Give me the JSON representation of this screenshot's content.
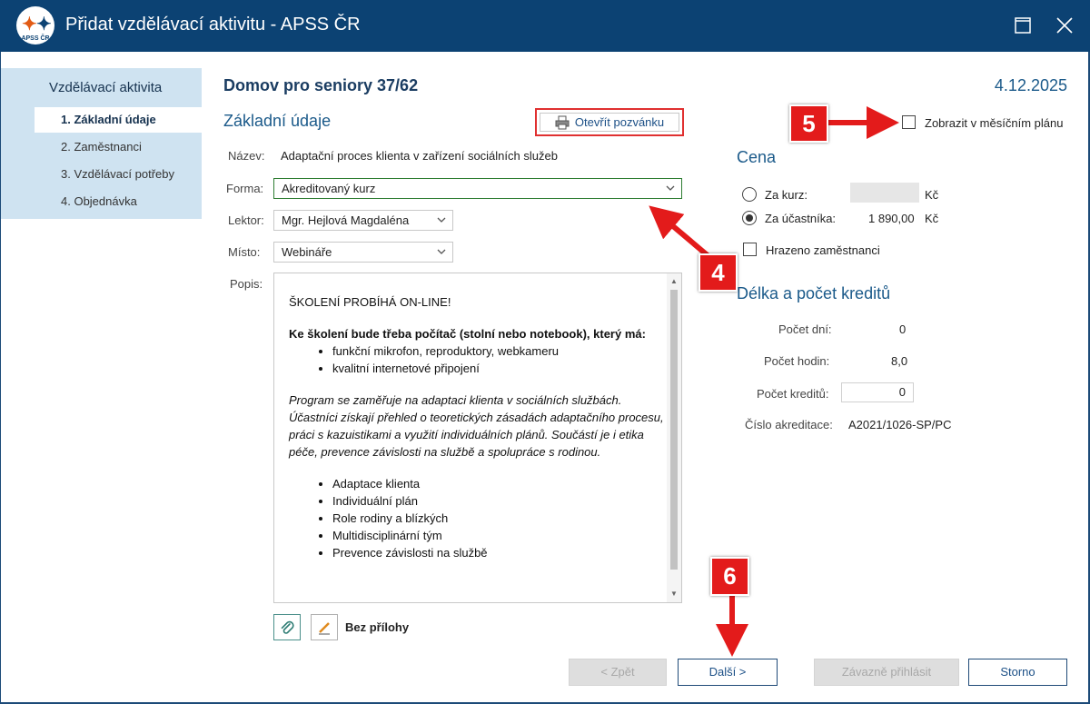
{
  "window": {
    "title": "Přidat vzdělávací aktivitu - APSS ČR",
    "logo_text": "APSS ČR"
  },
  "sidebar": {
    "title": "Vzdělávací aktivita",
    "items": [
      {
        "label": "1. Základní údaje"
      },
      {
        "label": "2. Zaměstnanci"
      },
      {
        "label": "3. Vzdělávací potřeby"
      },
      {
        "label": "4. Objednávka"
      }
    ]
  },
  "header": {
    "organization": "Domov pro seniory 37/62",
    "date": "4.12.2025"
  },
  "basic": {
    "section_title": "Základní údaje",
    "open_invite_label": "Otevřít pozvánku",
    "name_label": "Název:",
    "name_value": "Adaptační proces klienta v zařízení sociálních služeb",
    "form_label": "Forma:",
    "form_value": "Akreditovaný kurz",
    "lecturer_label": "Lektor:",
    "lecturer_value": "Mgr. Hejlová Magdaléna",
    "place_label": "Místo:",
    "place_value": "Webináře",
    "description_label": "Popis:"
  },
  "description": {
    "line1": "ŠKOLENÍ PROBÍHÁ ON-LINE!",
    "bold_line": "Ke školení bude třeba počítač (stolní nebo notebook), který má:",
    "requirements": [
      "funkční mikrofon, reproduktory, webkameru",
      "kvalitní internetové připojení"
    ],
    "italic_text": "Program se zaměřuje na adaptaci klienta v sociálních službách. Účastníci získají přehled o teoretických zásadách adaptačního procesu, práci s kazuistikami a využití individuálních plánů. Součástí je i etika péče, prevence závislosti na službě a spolupráce s rodinou.",
    "topics": [
      "Adaptace klienta",
      "Individuální plán",
      "Role rodiny a blízkých",
      "Multidisciplinární tým",
      "Prevence závislosti na službě"
    ]
  },
  "attachments": {
    "label": "Bez přílohy"
  },
  "monthly_plan": {
    "label": "Zobrazit v měsíčním plánu",
    "checked": false
  },
  "price": {
    "title": "Cena",
    "per_course_label": "Za kurz:",
    "per_course_value": "",
    "per_participant_label": "Za účastníka:",
    "per_participant_value": "1 890,00",
    "currency": "Kč",
    "selected": "per_participant",
    "employee_paid_label": "Hrazeno zaměstnanci",
    "employee_paid_checked": false
  },
  "credits": {
    "title": "Délka a počet kreditů",
    "days_label": "Počet dní:",
    "days_value": "0",
    "hours_label": "Počet hodin:",
    "hours_value": "8,0",
    "credits_label": "Počet kreditů:",
    "credits_value": "0",
    "accreditation_label": "Číslo akreditace:",
    "accreditation_value": "A2021/1026-SP/PC"
  },
  "footer": {
    "back_label": "< Zpět",
    "next_label": "Další >",
    "register_label": "Závazně přihlásit",
    "cancel_label": "Storno"
  },
  "annotations": {
    "marker_4": "4",
    "marker_5": "5",
    "marker_6": "6",
    "color": "#e31b1b"
  },
  "colors": {
    "titlebar": "#0c4273",
    "nav_background": "#cfe3f1",
    "accent_text": "#1b5a8a"
  }
}
